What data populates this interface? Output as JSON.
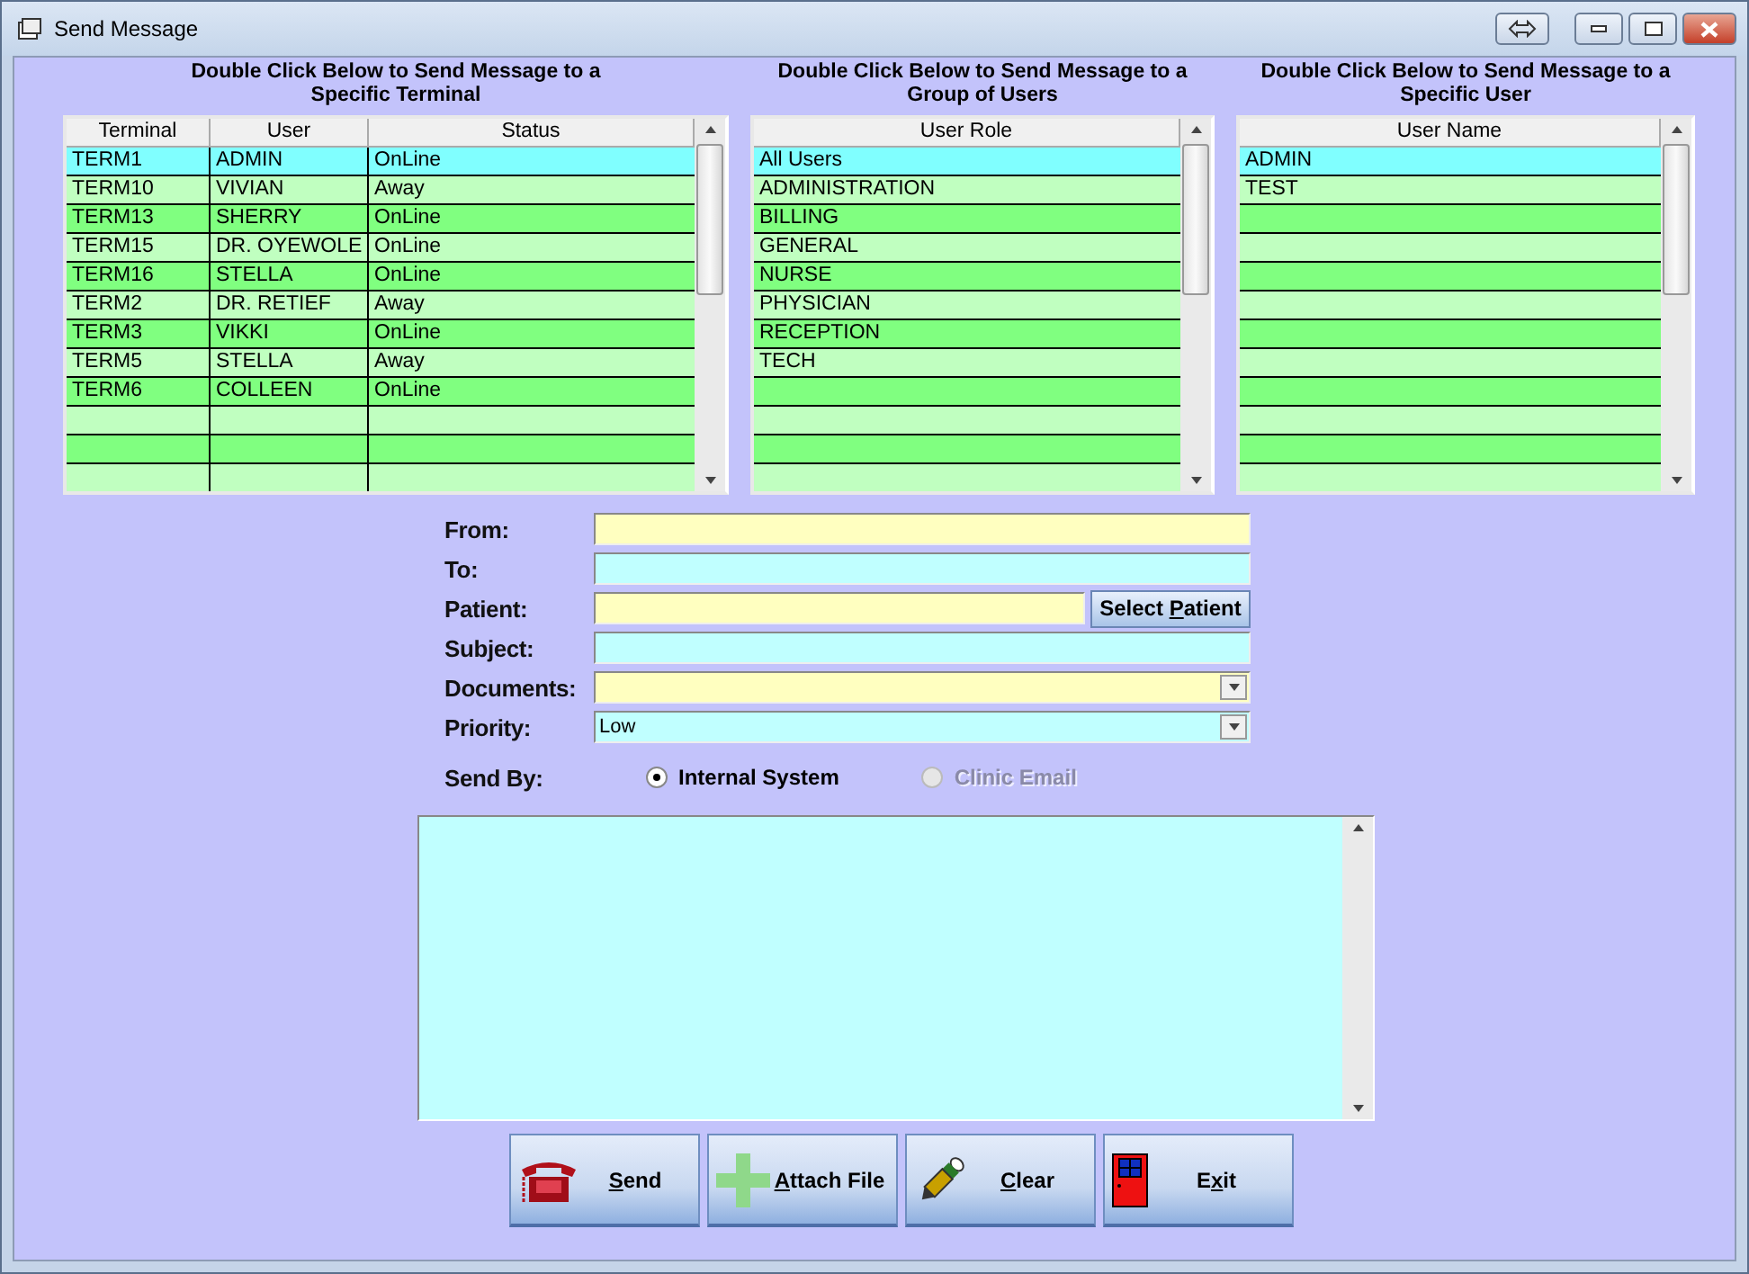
{
  "window": {
    "title": "Send Message"
  },
  "panels": [
    {
      "heading": "Double Click Below to Send Message to a Specific Terminal",
      "columns": [
        "Terminal",
        "User",
        "Status"
      ],
      "rows": [
        {
          "cells": [
            "TERM1",
            "ADMIN",
            "OnLine"
          ],
          "selected": true
        },
        {
          "cells": [
            "TERM10",
            "VIVIAN",
            "Away"
          ],
          "selected": false
        },
        {
          "cells": [
            "TERM13",
            "SHERRY",
            "OnLine"
          ],
          "selected": false
        },
        {
          "cells": [
            "TERM15",
            "DR. OYEWOLE",
            "OnLine"
          ],
          "selected": false
        },
        {
          "cells": [
            "TERM16",
            "STELLA",
            "OnLine"
          ],
          "selected": false
        },
        {
          "cells": [
            "TERM2",
            "DR. RETIEF",
            "Away"
          ],
          "selected": false
        },
        {
          "cells": [
            "TERM3",
            "VIKKI",
            "OnLine"
          ],
          "selected": false
        },
        {
          "cells": [
            "TERM5",
            "STELLA",
            "Away"
          ],
          "selected": false
        },
        {
          "cells": [
            "TERM6",
            "COLLEEN",
            "OnLine"
          ],
          "selected": false
        }
      ]
    },
    {
      "heading": "Double Click Below to Send Message to a Group of Users",
      "columns": [
        "User Role"
      ],
      "rows": [
        {
          "cells": [
            "All Users"
          ],
          "selected": true
        },
        {
          "cells": [
            "ADMINISTRATION"
          ],
          "selected": false
        },
        {
          "cells": [
            "BILLING"
          ],
          "selected": false
        },
        {
          "cells": [
            "GENERAL"
          ],
          "selected": false
        },
        {
          "cells": [
            "NURSE"
          ],
          "selected": false
        },
        {
          "cells": [
            "PHYSICIAN"
          ],
          "selected": false
        },
        {
          "cells": [
            "RECEPTION"
          ],
          "selected": false
        },
        {
          "cells": [
            "TECH"
          ],
          "selected": false
        }
      ]
    },
    {
      "heading": "Double Click Below to Send Message to a Specific User",
      "columns": [
        "User Name"
      ],
      "rows": [
        {
          "cells": [
            "ADMIN"
          ],
          "selected": true
        },
        {
          "cells": [
            "TEST"
          ],
          "selected": false
        }
      ]
    }
  ],
  "form": {
    "fields": [
      {
        "label": "From:",
        "kind": "text",
        "color": "#ffffc0"
      },
      {
        "label": "To:",
        "kind": "text",
        "color": "#c0ffff"
      },
      {
        "label": "Patient:",
        "kind": "button",
        "color": "#ffffc0",
        "button": {
          "before": "Select ",
          "key": "P",
          "after": "atient"
        }
      },
      {
        "label": "Subject:",
        "kind": "text",
        "color": "#c0ffff"
      },
      {
        "label": "Documents:",
        "kind": "combo",
        "color": "#ffffc0"
      },
      {
        "label": "Priority:",
        "kind": "combo",
        "color": "#c0ffff",
        "value": "Low"
      }
    ],
    "send_by": {
      "label": "Send By:",
      "options": [
        {
          "label": "Internal System",
          "selected": true,
          "disabled": false
        },
        {
          "label": "Clinic Email",
          "selected": false,
          "disabled": true
        }
      ]
    }
  },
  "buttons": [
    {
      "kind": "phone",
      "key": "S",
      "after": "end"
    },
    {
      "kind": "plus",
      "key": "A",
      "after": "ttach File"
    },
    {
      "kind": "brush",
      "key": "C",
      "after": "lear"
    },
    {
      "kind": "door",
      "before": "E",
      "key": "x",
      "after": "it"
    }
  ]
}
